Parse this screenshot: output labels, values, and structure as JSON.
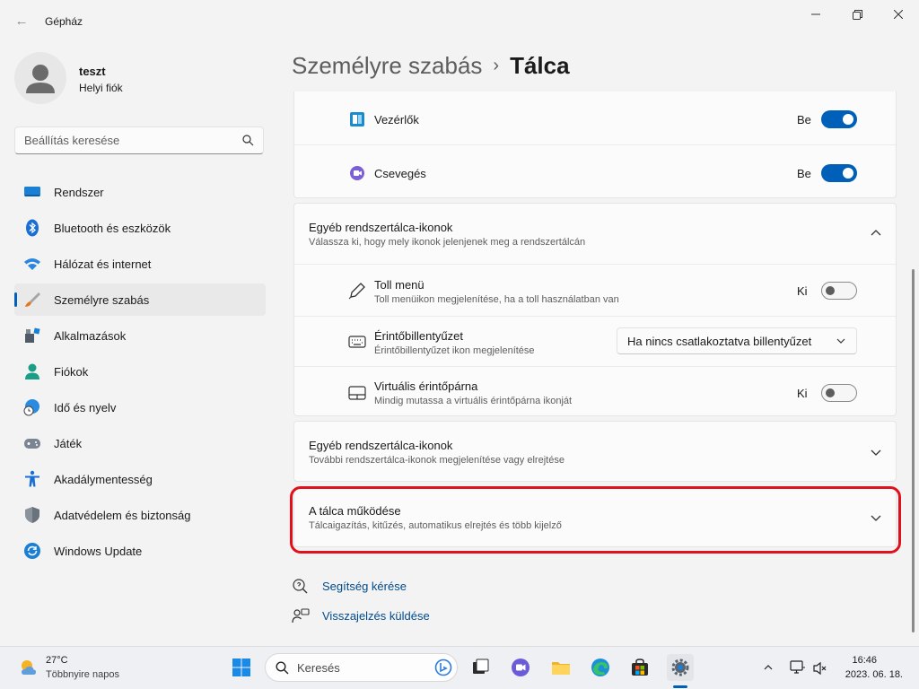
{
  "window": {
    "title": "Gépház"
  },
  "profile": {
    "name": "teszt",
    "account_type": "Helyi fiók"
  },
  "search": {
    "placeholder": "Beállítás keresése"
  },
  "nav": {
    "items": [
      {
        "label": "Rendszer",
        "icon": "monitor-icon"
      },
      {
        "label": "Bluetooth és eszközök",
        "icon": "bluetooth-icon"
      },
      {
        "label": "Hálózat és internet",
        "icon": "wifi-icon"
      },
      {
        "label": "Személyre szabás",
        "icon": "brush-icon",
        "active": true
      },
      {
        "label": "Alkalmazások",
        "icon": "apps-icon"
      },
      {
        "label": "Fiókok",
        "icon": "person-icon"
      },
      {
        "label": "Idő és nyelv",
        "icon": "globe-clock-icon"
      },
      {
        "label": "Játék",
        "icon": "gamepad-icon"
      },
      {
        "label": "Akadálymentesség",
        "icon": "accessibility-icon"
      },
      {
        "label": "Adatvédelem és biztonság",
        "icon": "shield-icon"
      },
      {
        "label": "Windows Update",
        "icon": "update-icon"
      }
    ]
  },
  "breadcrumb": {
    "parent": "Személyre szabás",
    "separator": "›",
    "current": "Tálca"
  },
  "taskbar_items_card": {
    "rows": [
      {
        "title": "Vezérlők",
        "state": "Be",
        "on": true,
        "icon": "widgets-icon"
      },
      {
        "title": "Csevegés",
        "state": "Be",
        "on": true,
        "icon": "chat-icon"
      }
    ]
  },
  "corner_icons": {
    "title": "Egyéb rendszertálca-ikonok",
    "description": "Válassza ki, hogy mely ikonok jelenjenek meg a rendszertálcán",
    "rows": [
      {
        "title": "Toll menü",
        "description": "Toll menüikon megjelenítése, ha a toll használatban van",
        "state": "Ki",
        "on": false,
        "icon": "pen-icon"
      },
      {
        "title": "Érintőbillentyűzet",
        "description": "Érintőbillentyűzet ikon megjelenítése",
        "dropdown_value": "Ha nincs csatlakoztatva billentyűzet",
        "icon": "keyboard-icon"
      },
      {
        "title": "Virtuális érintőpárna",
        "description": "Mindig mutassa a virtuális érintőpárna ikonját",
        "state": "Ki",
        "on": false,
        "icon": "touchpad-icon"
      }
    ]
  },
  "overflow_icons": {
    "title": "Egyéb rendszertálca-ikonok",
    "description": "További rendszertálca-ikonok megjelenítése vagy elrejtése"
  },
  "taskbar_behaviors": {
    "title": "A tálca működése",
    "description": "Tálcaigazítás, kitűzés, automatikus elrejtés és több kijelző"
  },
  "links": {
    "help": "Segítség kérése",
    "feedback": "Visszajelzés küldése"
  },
  "taskbar": {
    "weather_temp": "27°C",
    "weather_condition": "Többnyire napos",
    "search_label": "Keresés",
    "time": "16:46",
    "date": "2023. 06. 18."
  },
  "colors": {
    "accent": "#005fb8",
    "highlight": "#e0111c"
  }
}
